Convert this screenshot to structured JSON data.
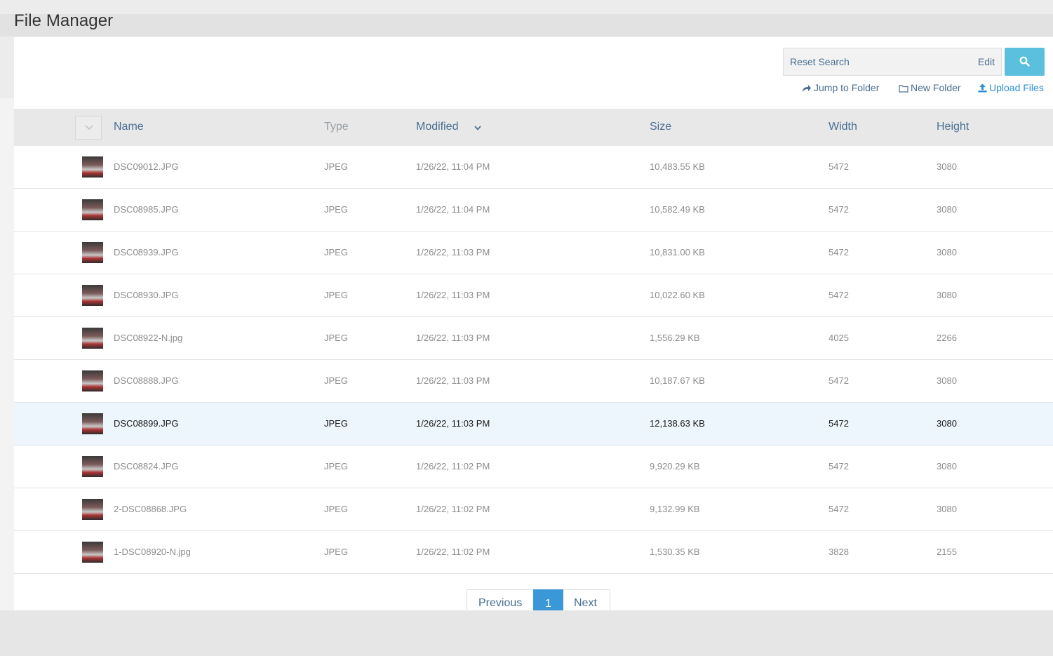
{
  "title": "File Manager",
  "search": {
    "reset_label": "Reset Search",
    "edit_label": "Edit",
    "button_icon": "search-icon"
  },
  "actions": {
    "jump": {
      "label": "Jump to Folder",
      "icon": "share-arrow-icon"
    },
    "new_folder": {
      "label": "New Folder",
      "icon": "folder-icon"
    },
    "upload": {
      "label": "Upload Files",
      "icon": "upload-icon"
    }
  },
  "columns": {
    "name": "Name",
    "type": "Type",
    "modified": "Modified",
    "size": "Size",
    "width": "Width",
    "height": "Height"
  },
  "sort": {
    "column": "Modified",
    "direction": "descending"
  },
  "files": [
    {
      "name": "DSC09012.JPG",
      "type": "JPEG",
      "modified": "1/26/22, 11:04 PM",
      "size": "10,483.55 KB",
      "width": "5472",
      "height": "3080"
    },
    {
      "name": "DSC08985.JPG",
      "type": "JPEG",
      "modified": "1/26/22, 11:04 PM",
      "size": "10,582.49 KB",
      "width": "5472",
      "height": "3080"
    },
    {
      "name": "DSC08939.JPG",
      "type": "JPEG",
      "modified": "1/26/22, 11:03 PM",
      "size": "10,831.00 KB",
      "width": "5472",
      "height": "3080"
    },
    {
      "name": "DSC08930.JPG",
      "type": "JPEG",
      "modified": "1/26/22, 11:03 PM",
      "size": "10,022.60 KB",
      "width": "5472",
      "height": "3080"
    },
    {
      "name": "DSC08922-N.jpg",
      "type": "JPEG",
      "modified": "1/26/22, 11:03 PM",
      "size": "1,556.29 KB",
      "width": "4025",
      "height": "2266"
    },
    {
      "name": "DSC08888.JPG",
      "type": "JPEG",
      "modified": "1/26/22, 11:03 PM",
      "size": "10,187.67 KB",
      "width": "5472",
      "height": "3080"
    },
    {
      "name": "DSC08899.JPG",
      "type": "JPEG",
      "modified": "1/26/22, 11:03 PM",
      "size": "12,138.63 KB",
      "width": "5472",
      "height": "3080",
      "selected": true
    },
    {
      "name": "DSC08824.JPG",
      "type": "JPEG",
      "modified": "1/26/22, 11:02 PM",
      "size": "9,920.29 KB",
      "width": "5472",
      "height": "3080"
    },
    {
      "name": "2-DSC08868.JPG",
      "type": "JPEG",
      "modified": "1/26/22, 11:02 PM",
      "size": "9,132.99 KB",
      "width": "5472",
      "height": "3080"
    },
    {
      "name": "1-DSC08920-N.jpg",
      "type": "JPEG",
      "modified": "1/26/22, 11:02 PM",
      "size": "1,530.35 KB",
      "width": "3828",
      "height": "2155"
    }
  ],
  "pagination": {
    "previous": "Previous",
    "current": "1",
    "next": "Next"
  },
  "colors": {
    "accent": "#3b98d8",
    "search_button": "#5bc0de",
    "link": "#4a6f93",
    "selected_row": "#edf5fd"
  }
}
